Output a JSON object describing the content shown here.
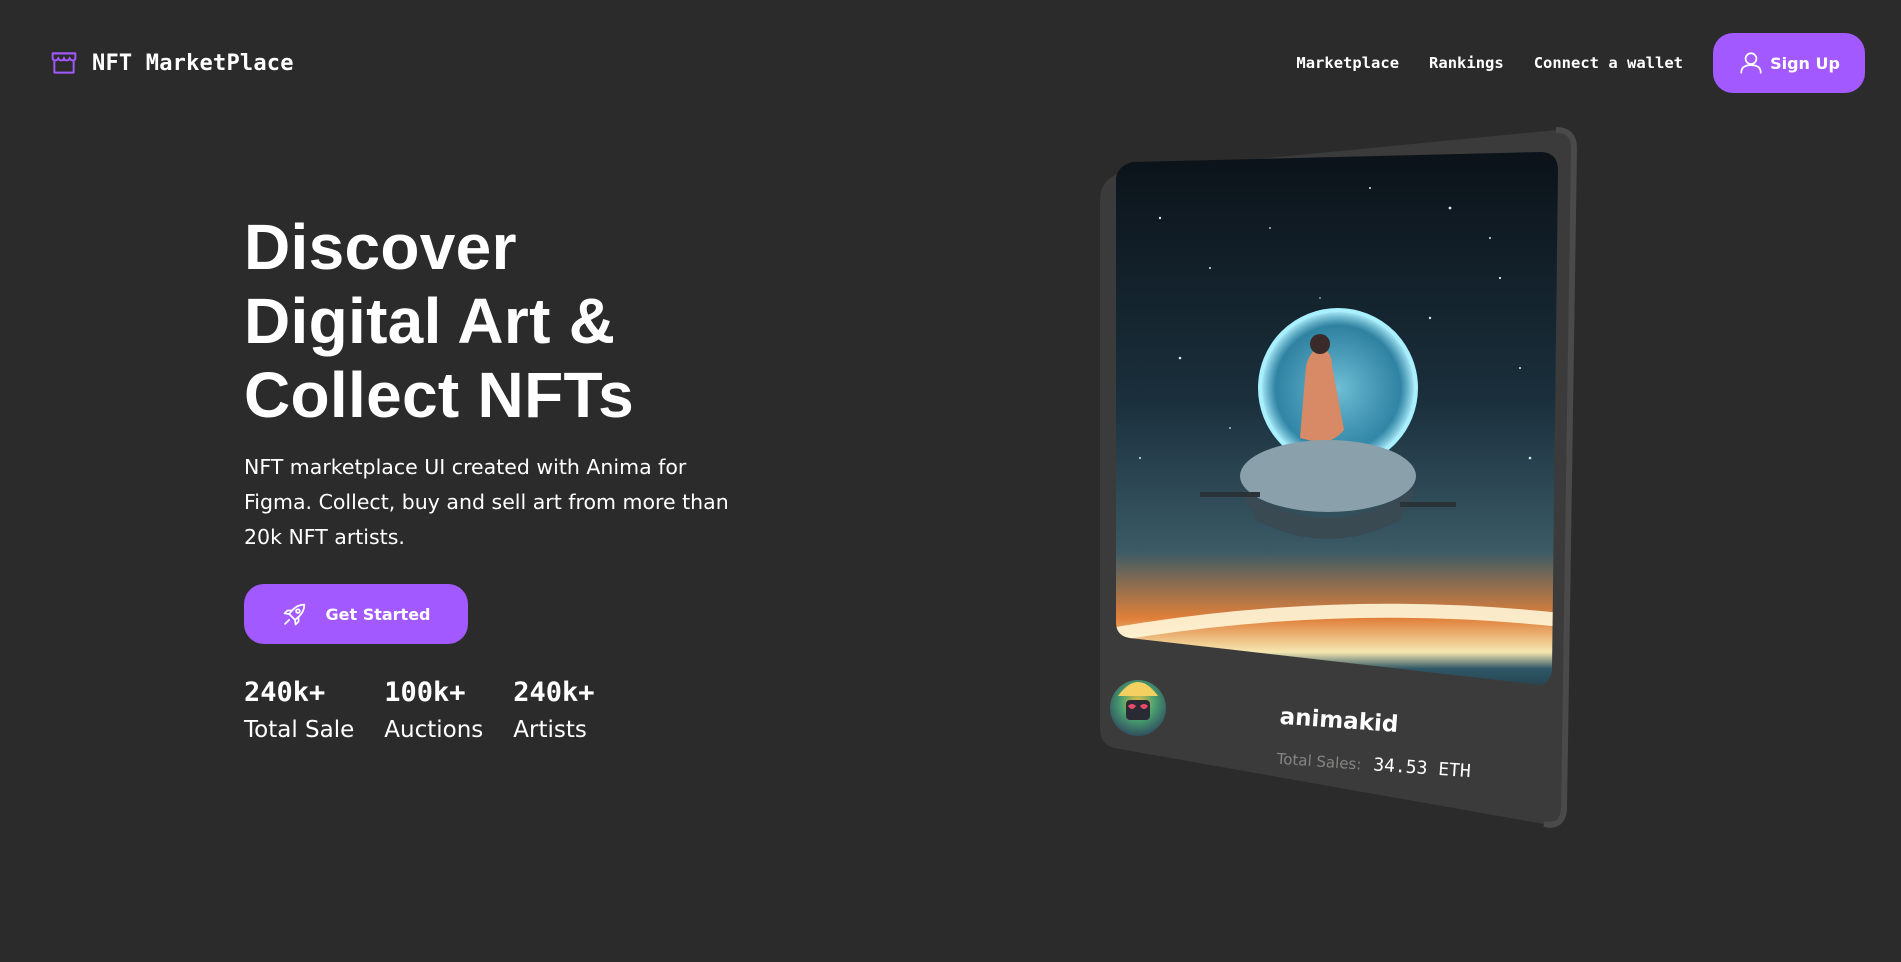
{
  "brand": {
    "name": "NFT MarketPlace",
    "icon": "storefront-icon",
    "accent": "#a259ff"
  },
  "nav": {
    "links": [
      "Marketplace",
      "Rankings",
      "Connect a wallet"
    ],
    "signup_label": "Sign Up",
    "signup_icon": "user-icon"
  },
  "hero": {
    "title_lines": [
      "Discover",
      "Digital Art &",
      "Collect NFTs"
    ],
    "description": "NFT marketplace UI created with Anima for Figma. Collect, buy and sell art from more than 20k NFT artists.",
    "cta_label": "Get Started",
    "cta_icon": "rocket-icon"
  },
  "stats": [
    {
      "value": "240k+",
      "label": "Total Sale"
    },
    {
      "value": "100k+",
      "label": "Auctions"
    },
    {
      "value": "240k+",
      "label": "Artists"
    }
  ],
  "featured": {
    "artist_name": "animakid",
    "sales_label": "Total Sales:",
    "sales_value": "34.53 ETH",
    "background": "#3b3b3b"
  },
  "colors": {
    "background": "#2b2b2b",
    "card": "#3b3b3b",
    "muted_text": "#858584"
  }
}
